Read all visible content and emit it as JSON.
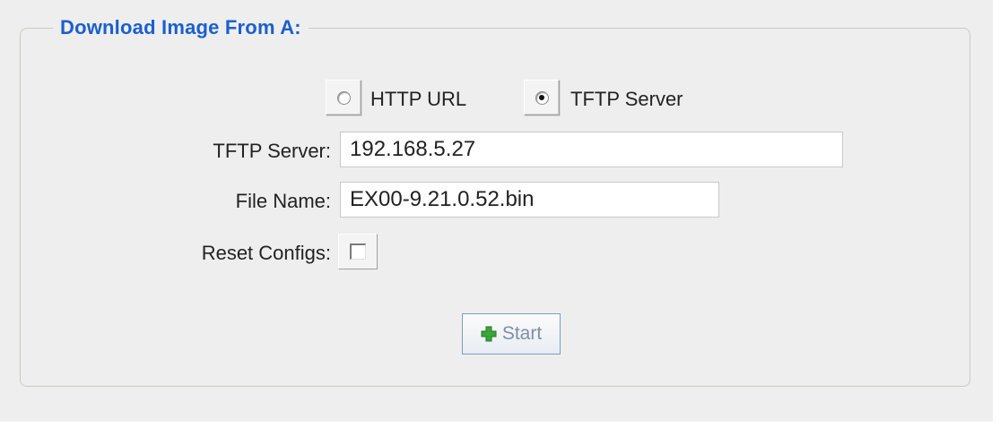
{
  "group": {
    "legend": "Download Image From A:"
  },
  "source": {
    "options": [
      {
        "label": "HTTP URL",
        "selected": false
      },
      {
        "label": "TFTP Server",
        "selected": true
      }
    ]
  },
  "form": {
    "tftp_server_label": "TFTP Server:",
    "tftp_server_value": "192.168.5.27",
    "file_name_label": "File Name:",
    "file_name_value": "EX00-9.21.0.52.bin",
    "reset_configs_label": "Reset Configs:",
    "reset_configs_checked": false
  },
  "actions": {
    "start_label": "Start",
    "start_icon": "plus-icon"
  },
  "colors": {
    "legend": "#1b5fcf",
    "panel_bg": "#eeeeee",
    "plus_green": "#3aa53a"
  }
}
